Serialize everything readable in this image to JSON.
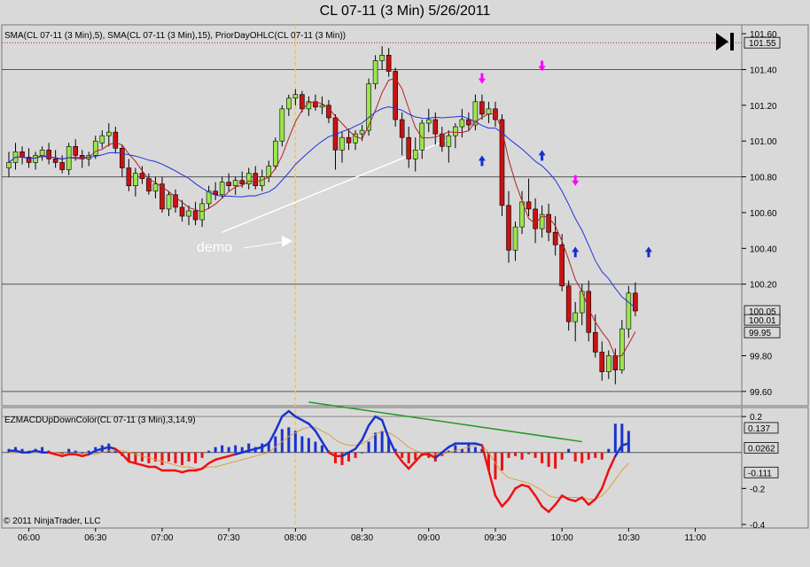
{
  "window": {
    "title": "CL 07-11 (3 Min)  5/26/2011",
    "copyright": "© 2011 NinjaTrader, LLC",
    "scroll_icon": "play-end-icon"
  },
  "colors": {
    "background": "#d9d9d9",
    "up_candle": "#99e64d",
    "down_candle": "#cc1111",
    "sma5": "#b22222",
    "sma15": "#2233dd",
    "macd_up": "#1a33cc",
    "macd_down": "#ee1111",
    "signal_line": "#d9a040",
    "vertical_marker": "#ffcc00",
    "trendline_price": "#ffffff",
    "trendline_macd": "#229922",
    "arrow_up": "#1030d0",
    "arrow_down": "#ff00ff",
    "prior_day_line": "#aa2222"
  },
  "chart_data": [
    {
      "type": "candlestick",
      "panel": "price",
      "indicator_label": "SMA(CL 07-11 (3 Min),5), SMA(CL 07-11 (3 Min),15), PriorDayOHLC(CL 07-11 (3 Min))",
      "x_ticks": [
        "06:00",
        "06:30",
        "07:00",
        "07:30",
        "08:00",
        "08:30",
        "09:00",
        "09:30",
        "10:00",
        "10:30",
        "11:00"
      ],
      "y_ticks": [
        "101.60",
        "101.40",
        "101.20",
        "101.00",
        "100.80",
        "100.60",
        "100.40",
        "100.20",
        "99.80",
        "99.60"
      ],
      "ylim": [
        99.52,
        101.65
      ],
      "price_markers": [
        "101.55",
        "100.05",
        "100.01",
        "99.95"
      ],
      "prior_day_level": 101.55,
      "horizontal_lines": [
        101.4,
        100.8,
        100.2,
        99.6
      ],
      "vertical_marker_time": "08:00",
      "annotation": "demo",
      "candle_interval_minutes": 3,
      "candle_count": 94,
      "candles": [
        [
          100.85,
          100.94,
          100.8,
          100.88
        ],
        [
          100.88,
          100.99,
          100.84,
          100.94
        ],
        [
          100.94,
          100.97,
          100.87,
          100.91
        ],
        [
          100.91,
          100.96,
          100.85,
          100.88
        ],
        [
          100.88,
          100.94,
          100.84,
          100.92
        ],
        [
          100.92,
          100.97,
          100.89,
          100.95
        ],
        [
          100.95,
          100.99,
          100.87,
          100.9
        ],
        [
          100.9,
          100.95,
          100.85,
          100.88
        ],
        [
          100.88,
          100.92,
          100.82,
          100.84
        ],
        [
          100.84,
          100.99,
          100.81,
          100.97
        ],
        [
          100.97,
          101.01,
          100.89,
          100.92
        ],
        [
          100.92,
          100.95,
          100.85,
          100.9
        ],
        [
          100.9,
          100.94,
          100.86,
          100.92
        ],
        [
          100.92,
          101.03,
          100.9,
          101.0
        ],
        [
          100.99,
          101.06,
          100.96,
          101.03
        ],
        [
          101.03,
          101.1,
          100.97,
          101.05
        ],
        [
          101.05,
          101.08,
          100.93,
          100.96
        ],
        [
          100.96,
          100.98,
          100.8,
          100.85
        ],
        [
          100.85,
          100.9,
          100.72,
          100.75
        ],
        [
          100.75,
          100.85,
          100.69,
          100.82
        ],
        [
          100.82,
          100.86,
          100.76,
          100.79
        ],
        [
          100.79,
          100.82,
          100.7,
          100.72
        ],
        [
          100.72,
          100.8,
          100.68,
          100.76
        ],
        [
          100.76,
          100.8,
          100.6,
          100.62
        ],
        [
          100.62,
          100.72,
          100.58,
          100.7
        ],
        [
          100.7,
          100.73,
          100.6,
          100.63
        ],
        [
          100.63,
          100.67,
          100.55,
          100.58
        ],
        [
          100.58,
          100.64,
          100.53,
          100.61
        ],
        [
          100.61,
          100.66,
          100.53,
          100.56
        ],
        [
          100.56,
          100.68,
          100.52,
          100.65
        ],
        [
          100.65,
          100.75,
          100.62,
          100.72
        ],
        [
          100.72,
          100.77,
          100.67,
          100.7
        ],
        [
          100.7,
          100.8,
          100.68,
          100.77
        ],
        [
          100.77,
          100.82,
          100.72,
          100.75
        ],
        [
          100.75,
          100.8,
          100.7,
          100.78
        ],
        [
          100.78,
          100.83,
          100.74,
          100.76
        ],
        [
          100.76,
          100.85,
          100.73,
          100.82
        ],
        [
          100.82,
          100.86,
          100.73,
          100.75
        ],
        [
          100.75,
          100.84,
          100.72,
          100.8
        ],
        [
          100.8,
          100.89,
          100.77,
          100.86
        ],
        [
          100.86,
          101.02,
          100.84,
          101.0
        ],
        [
          101.0,
          101.2,
          100.97,
          101.18
        ],
        [
          101.18,
          101.26,
          101.14,
          101.24
        ],
        [
          101.24,
          101.29,
          101.2,
          101.26
        ],
        [
          101.26,
          101.28,
          101.16,
          101.18
        ],
        [
          101.18,
          101.25,
          101.14,
          101.22
        ],
        [
          101.22,
          101.26,
          101.17,
          101.19
        ],
        [
          101.19,
          101.25,
          101.15,
          101.2
        ],
        [
          101.2,
          101.23,
          101.1,
          101.13
        ],
        [
          101.13,
          101.15,
          100.84,
          100.95
        ],
        [
          100.95,
          101.05,
          100.88,
          101.02
        ],
        [
          101.02,
          101.07,
          100.95,
          100.99
        ],
        [
          100.99,
          101.06,
          100.95,
          101.04
        ],
        [
          101.04,
          101.09,
          101.0,
          101.06
        ],
        [
          101.06,
          101.35,
          101.03,
          101.32
        ],
        [
          101.32,
          101.48,
          101.29,
          101.45
        ],
        [
          101.45,
          101.53,
          101.4,
          101.48
        ],
        [
          101.48,
          101.52,
          101.36,
          101.39
        ],
        [
          101.39,
          101.41,
          101.08,
          101.12
        ],
        [
          101.12,
          101.16,
          100.92,
          101.02
        ],
        [
          101.02,
          101.08,
          100.85,
          100.9
        ],
        [
          100.9,
          101.02,
          100.83,
          100.95
        ],
        [
          100.95,
          101.12,
          100.9,
          101.1
        ],
        [
          101.1,
          101.18,
          101.05,
          101.12
        ],
        [
          101.12,
          101.16,
          100.98,
          101.04
        ],
        [
          101.04,
          101.08,
          100.94,
          100.97
        ],
        [
          100.97,
          101.06,
          100.88,
          101.03
        ],
        [
          101.03,
          101.1,
          100.96,
          101.08
        ],
        [
          101.08,
          101.18,
          101.02,
          101.12
        ],
        [
          101.12,
          101.16,
          101.06,
          101.09
        ],
        [
          101.09,
          101.26,
          101.06,
          101.22
        ],
        [
          101.22,
          101.26,
          101.12,
          101.15
        ],
        [
          101.15,
          101.22,
          101.1,
          101.18
        ],
        [
          101.18,
          101.22,
          101.08,
          101.12
        ],
        [
          101.12,
          101.15,
          100.58,
          100.64
        ],
        [
          100.64,
          100.72,
          100.32,
          100.39
        ],
        [
          100.39,
          100.55,
          100.33,
          100.52
        ],
        [
          100.52,
          100.72,
          100.48,
          100.66
        ],
        [
          100.66,
          100.79,
          100.58,
          100.62
        ],
        [
          100.62,
          100.68,
          100.43,
          100.51
        ],
        [
          100.51,
          100.64,
          100.46,
          100.59
        ],
        [
          100.59,
          100.65,
          100.44,
          100.49
        ],
        [
          100.49,
          100.58,
          100.36,
          100.42
        ],
        [
          100.42,
          100.48,
          100.16,
          100.19
        ],
        [
          100.19,
          100.22,
          99.94,
          99.99
        ],
        [
          99.99,
          100.1,
          99.88,
          100.04
        ],
        [
          100.04,
          100.2,
          99.97,
          100.16
        ],
        [
          100.16,
          100.22,
          99.88,
          99.93
        ],
        [
          99.93,
          100.03,
          99.79,
          99.82
        ],
        [
          99.82,
          99.88,
          99.66,
          99.71
        ],
        [
          99.71,
          99.83,
          99.67,
          99.8
        ],
        [
          99.8,
          99.84,
          99.64,
          99.72
        ],
        [
          99.72,
          100.0,
          99.7,
          99.95
        ],
        [
          99.95,
          100.19,
          99.9,
          100.15
        ],
        [
          100.15,
          100.21,
          100.02,
          100.05
        ]
      ],
      "series": [
        {
          "name": "SMA(CL 07-11 (3 Min),5)",
          "period": 5
        },
        {
          "name": "SMA(CL 07-11 (3 Min),15)",
          "period": 15
        }
      ],
      "trendline": {
        "from": [
          "07:27",
          100.49
        ],
        "to": [
          "09:09",
          101.01
        ]
      },
      "signals": {
        "up_arrows": [
          [
            "09:24",
            100.92
          ],
          [
            "09:51",
            100.95
          ],
          [
            "10:06",
            100.41
          ],
          [
            "10:39",
            100.41
          ]
        ],
        "down_arrows": [
          [
            "09:24",
            101.32
          ],
          [
            "09:51",
            101.39
          ],
          [
            "10:06",
            100.75
          ]
        ]
      }
    },
    {
      "type": "histogram_line",
      "panel": "indicator",
      "indicator_label": "EZMACDUpDownColor(CL 07-11 (3 Min),3,14,9)",
      "y_ticks": [
        "0.2",
        "-0.2",
        "-0.4"
      ],
      "ylim": [
        -0.42,
        0.25
      ],
      "value_markers": [
        "0.137",
        "0.0262",
        "-0.111"
      ],
      "histogram": [
        0.02,
        0.03,
        0.02,
        0.01,
        0.02,
        0.03,
        0.01,
        0.0,
        -0.01,
        0.02,
        0.01,
        0.0,
        0.01,
        0.03,
        0.04,
        0.05,
        0.02,
        -0.02,
        -0.05,
        -0.06,
        -0.05,
        -0.06,
        -0.05,
        -0.07,
        -0.05,
        -0.06,
        -0.07,
        -0.05,
        -0.06,
        -0.03,
        0.01,
        0.03,
        0.04,
        0.03,
        0.04,
        0.03,
        0.05,
        0.03,
        0.05,
        0.06,
        0.09,
        0.13,
        0.14,
        0.12,
        0.09,
        0.08,
        0.06,
        0.04,
        0.01,
        -0.06,
        -0.07,
        -0.05,
        -0.03,
        0.0,
        0.06,
        0.11,
        0.12,
        0.08,
        0.02,
        -0.03,
        -0.06,
        -0.04,
        -0.02,
        -0.03,
        -0.05,
        -0.02,
        0.01,
        0.04,
        0.02,
        0.05,
        0.03,
        0.02,
        -0.1,
        -0.15,
        -0.1,
        -0.03,
        -0.02,
        -0.04,
        -0.01,
        -0.03,
        -0.06,
        -0.08,
        -0.09,
        -0.04,
        0.02,
        -0.05,
        -0.06,
        -0.04,
        -0.03,
        -0.04,
        0.02,
        0.16,
        0.16,
        0.12
      ],
      "macd": [
        0.01,
        0.01,
        0.0,
        0.0,
        0.01,
        0.0,
        0.0,
        -0.01,
        -0.02,
        -0.01,
        -0.01,
        -0.02,
        -0.01,
        0.01,
        0.02,
        0.03,
        0.02,
        -0.01,
        -0.05,
        -0.06,
        -0.07,
        -0.08,
        -0.08,
        -0.1,
        -0.1,
        -0.1,
        -0.11,
        -0.1,
        -0.1,
        -0.09,
        -0.06,
        -0.04,
        -0.03,
        -0.02,
        -0.01,
        0.0,
        0.01,
        0.02,
        0.03,
        0.05,
        0.12,
        0.2,
        0.23,
        0.2,
        0.18,
        0.16,
        0.12,
        0.06,
        0.0,
        -0.02,
        -0.02,
        0.0,
        0.02,
        0.07,
        0.15,
        0.2,
        0.18,
        0.08,
        0.0,
        -0.05,
        -0.09,
        -0.05,
        -0.01,
        -0.01,
        -0.03,
        0.0,
        0.03,
        0.05,
        0.05,
        0.05,
        0.05,
        0.04,
        -0.1,
        -0.24,
        -0.3,
        -0.26,
        -0.2,
        -0.18,
        -0.19,
        -0.24,
        -0.3,
        -0.33,
        -0.29,
        -0.24,
        -0.26,
        -0.27,
        -0.25,
        -0.29,
        -0.26,
        -0.2,
        -0.1,
        -0.02,
        0.04,
        0.05
      ],
      "signal": [
        0.0,
        0.0,
        0.0,
        0.0,
        0.0,
        0.0,
        0.0,
        0.0,
        -0.01,
        -0.01,
        -0.01,
        -0.01,
        -0.01,
        -0.01,
        0.0,
        0.01,
        0.01,
        0.01,
        0.0,
        -0.01,
        -0.02,
        -0.03,
        -0.04,
        -0.05,
        -0.06,
        -0.07,
        -0.08,
        -0.08,
        -0.09,
        -0.09,
        -0.08,
        -0.08,
        -0.07,
        -0.06,
        -0.05,
        -0.04,
        -0.03,
        -0.02,
        -0.01,
        0.0,
        0.03,
        0.06,
        0.09,
        0.11,
        0.13,
        0.14,
        0.14,
        0.12,
        0.1,
        0.07,
        0.05,
        0.04,
        0.04,
        0.05,
        0.07,
        0.1,
        0.12,
        0.11,
        0.09,
        0.06,
        0.03,
        0.01,
        0.0,
        -0.01,
        -0.01,
        -0.01,
        0.0,
        0.01,
        0.02,
        0.03,
        0.04,
        0.04,
        0.0,
        -0.06,
        -0.11,
        -0.14,
        -0.15,
        -0.16,
        -0.17,
        -0.19,
        -0.21,
        -0.24,
        -0.25,
        -0.25,
        -0.25,
        -0.25,
        -0.25,
        -0.26,
        -0.26,
        -0.24,
        -0.2,
        -0.15,
        -0.1,
        -0.06
      ],
      "trendline": {
        "from": [
          "08:06",
          0.28
        ],
        "to": [
          "10:09",
          0.06
        ]
      }
    }
  ]
}
